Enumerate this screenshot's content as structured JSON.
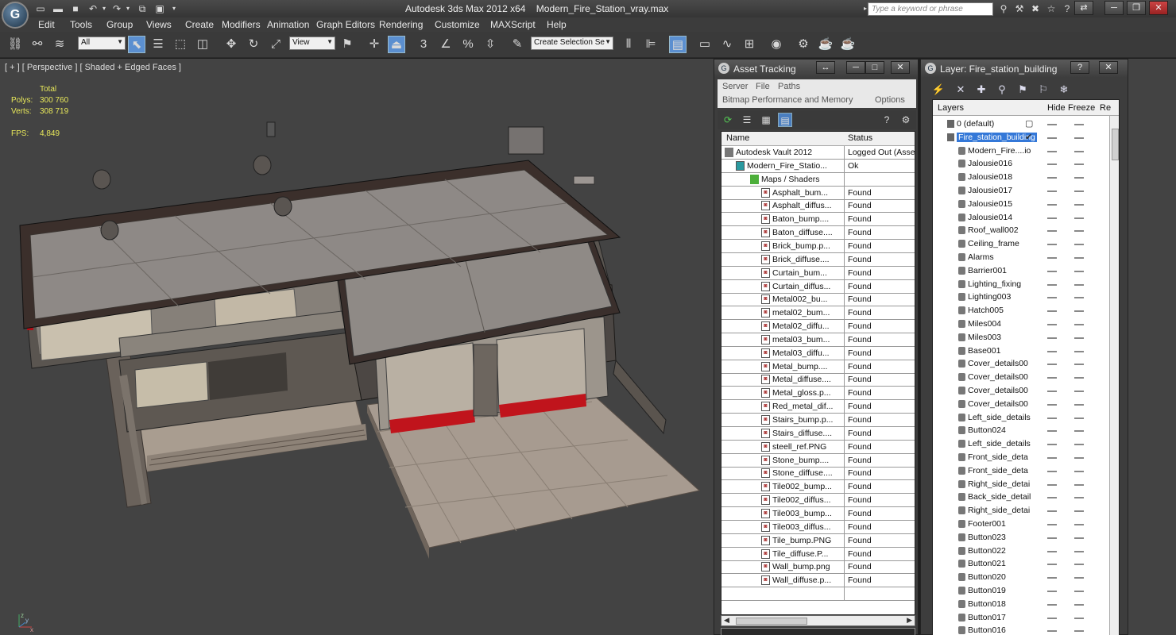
{
  "window": {
    "app_name": "Autodesk 3ds Max  2012 x64",
    "file_name": "Modern_Fire_Station_vray.max",
    "search_placeholder": "Type a keyword or phrase",
    "logo_letter": "G"
  },
  "menu": [
    "Edit",
    "Tools",
    "Group",
    "Views",
    "Create",
    "Modifiers",
    "Animation",
    "Graph Editors",
    "Rendering",
    "Customize",
    "MAXScript",
    "Help"
  ],
  "toolbar": {
    "filter_select": "All",
    "coord_select": "View",
    "selection_set": "Create Selection Se",
    "snap_labels": [
      "3",
      "%"
    ]
  },
  "viewport": {
    "label": "[ + ] [ Perspective ] [ Shaded + Edged Faces ]",
    "stats": {
      "total_label": "Total",
      "polys_label": "Polys:",
      "polys_value": "300 760",
      "verts_label": "Verts:",
      "verts_value": "308 719",
      "fps_label": "FPS:",
      "fps_value": "4,849"
    },
    "axis": {
      "x": "x",
      "y": "y",
      "z": "z"
    }
  },
  "asset_tracking": {
    "title": "Asset Tracking",
    "menu_row1": [
      "Server",
      "File",
      "Paths"
    ],
    "menu_row2": [
      "Bitmap Performance and Memory",
      "Options"
    ],
    "columns": {
      "name": "Name",
      "status": "Status"
    },
    "rows": [
      {
        "name": "Autodesk Vault 2012",
        "status": "Logged Out (Asse",
        "level": 0,
        "kind": "vault"
      },
      {
        "name": "Modern_Fire_Statio...",
        "status": "Ok",
        "level": 1,
        "kind": "max"
      },
      {
        "name": "Maps / Shaders",
        "status": "",
        "level": 2,
        "kind": "folder"
      },
      {
        "name": "Asphalt_bum...",
        "status": "Found",
        "level": 3,
        "kind": "file"
      },
      {
        "name": "Asphalt_diffus...",
        "status": "Found",
        "level": 3,
        "kind": "file"
      },
      {
        "name": "Baton_bump....",
        "status": "Found",
        "level": 3,
        "kind": "file"
      },
      {
        "name": "Baton_diffuse....",
        "status": "Found",
        "level": 3,
        "kind": "file"
      },
      {
        "name": "Brick_bump.p...",
        "status": "Found",
        "level": 3,
        "kind": "file"
      },
      {
        "name": "Brick_diffuse....",
        "status": "Found",
        "level": 3,
        "kind": "file"
      },
      {
        "name": "Curtain_bum...",
        "status": "Found",
        "level": 3,
        "kind": "file"
      },
      {
        "name": "Curtain_diffus...",
        "status": "Found",
        "level": 3,
        "kind": "file"
      },
      {
        "name": "Metal002_bu...",
        "status": "Found",
        "level": 3,
        "kind": "file"
      },
      {
        "name": "metal02_bum...",
        "status": "Found",
        "level": 3,
        "kind": "file"
      },
      {
        "name": "Metal02_diffu...",
        "status": "Found",
        "level": 3,
        "kind": "file"
      },
      {
        "name": "metal03_bum...",
        "status": "Found",
        "level": 3,
        "kind": "file"
      },
      {
        "name": "Metal03_diffu...",
        "status": "Found",
        "level": 3,
        "kind": "file"
      },
      {
        "name": "Metal_bump....",
        "status": "Found",
        "level": 3,
        "kind": "file"
      },
      {
        "name": "Metal_diffuse....",
        "status": "Found",
        "level": 3,
        "kind": "file"
      },
      {
        "name": "Metal_gloss.p...",
        "status": "Found",
        "level": 3,
        "kind": "file"
      },
      {
        "name": "Red_metal_dif...",
        "status": "Found",
        "level": 3,
        "kind": "file"
      },
      {
        "name": "Stairs_bump.p...",
        "status": "Found",
        "level": 3,
        "kind": "file"
      },
      {
        "name": "Stairs_diffuse....",
        "status": "Found",
        "level": 3,
        "kind": "file"
      },
      {
        "name": "steell_ref.PNG",
        "status": "Found",
        "level": 3,
        "kind": "file"
      },
      {
        "name": "Stone_bump....",
        "status": "Found",
        "level": 3,
        "kind": "file"
      },
      {
        "name": "Stone_diffuse....",
        "status": "Found",
        "level": 3,
        "kind": "file"
      },
      {
        "name": "Tile002_bump...",
        "status": "Found",
        "level": 3,
        "kind": "file"
      },
      {
        "name": "Tile002_diffus...",
        "status": "Found",
        "level": 3,
        "kind": "file"
      },
      {
        "name": "Tile003_bump...",
        "status": "Found",
        "level": 3,
        "kind": "file"
      },
      {
        "name": "Tile003_diffus...",
        "status": "Found",
        "level": 3,
        "kind": "file"
      },
      {
        "name": "Tile_bump.PNG",
        "status": "Found",
        "level": 3,
        "kind": "file"
      },
      {
        "name": "Tile_diffuse.P...",
        "status": "Found",
        "level": 3,
        "kind": "file"
      },
      {
        "name": "Wall_bump.png",
        "status": "Found",
        "level": 3,
        "kind": "file"
      },
      {
        "name": "Wall_diffuse.p...",
        "status": "Found",
        "level": 3,
        "kind": "file"
      },
      {
        "name": "",
        "status": "",
        "level": 0,
        "kind": "empty"
      }
    ]
  },
  "layer_panel": {
    "title": "Layer: Fire_station_building",
    "help": "?",
    "columns": {
      "layers": "Layers",
      "hide": "Hide",
      "freeze": "Freeze",
      "render": "Re"
    },
    "rows": [
      {
        "name": "0 (default)",
        "level": 0,
        "type": "layer",
        "mark": "box"
      },
      {
        "name": "Fire_station_building",
        "level": 0,
        "type": "layer",
        "selected": true,
        "mark": "check"
      },
      {
        "name": "Modern_Fire....io",
        "level": 1,
        "type": "object"
      },
      {
        "name": "Jalousie016",
        "level": 1,
        "type": "object"
      },
      {
        "name": "Jalousie018",
        "level": 1,
        "type": "object"
      },
      {
        "name": "Jalousie017",
        "level": 1,
        "type": "object"
      },
      {
        "name": "Jalousie015",
        "level": 1,
        "type": "object"
      },
      {
        "name": "Jalousie014",
        "level": 1,
        "type": "object"
      },
      {
        "name": "Roof_wall002",
        "level": 1,
        "type": "object"
      },
      {
        "name": "Ceiling_frame",
        "level": 1,
        "type": "object"
      },
      {
        "name": "Alarms",
        "level": 1,
        "type": "object"
      },
      {
        "name": "Barrier001",
        "level": 1,
        "type": "object"
      },
      {
        "name": "Lighting_fixing",
        "level": 1,
        "type": "object"
      },
      {
        "name": "Lighting003",
        "level": 1,
        "type": "object"
      },
      {
        "name": "Hatch005",
        "level": 1,
        "type": "object"
      },
      {
        "name": "Miles004",
        "level": 1,
        "type": "object"
      },
      {
        "name": "Miles003",
        "level": 1,
        "type": "object"
      },
      {
        "name": "Base001",
        "level": 1,
        "type": "object"
      },
      {
        "name": "Cover_details00",
        "level": 1,
        "type": "object"
      },
      {
        "name": "Cover_details00",
        "level": 1,
        "type": "object"
      },
      {
        "name": "Cover_details00",
        "level": 1,
        "type": "object"
      },
      {
        "name": "Cover_details00",
        "level": 1,
        "type": "object"
      },
      {
        "name": "Left_side_details",
        "level": 1,
        "type": "object"
      },
      {
        "name": "Button024",
        "level": 1,
        "type": "object"
      },
      {
        "name": "Left_side_details",
        "level": 1,
        "type": "object"
      },
      {
        "name": "Front_side_deta",
        "level": 1,
        "type": "object"
      },
      {
        "name": "Front_side_deta",
        "level": 1,
        "type": "object"
      },
      {
        "name": "Right_side_detai",
        "level": 1,
        "type": "object"
      },
      {
        "name": "Back_side_detail",
        "level": 1,
        "type": "object"
      },
      {
        "name": "Right_side_detai",
        "level": 1,
        "type": "object"
      },
      {
        "name": "Footer001",
        "level": 1,
        "type": "object"
      },
      {
        "name": "Button023",
        "level": 1,
        "type": "object"
      },
      {
        "name": "Button022",
        "level": 1,
        "type": "object"
      },
      {
        "name": "Button021",
        "level": 1,
        "type": "object"
      },
      {
        "name": "Button020",
        "level": 1,
        "type": "object"
      },
      {
        "name": "Button019",
        "level": 1,
        "type": "object"
      },
      {
        "name": "Button018",
        "level": 1,
        "type": "object"
      },
      {
        "name": "Button017",
        "level": 1,
        "type": "object"
      },
      {
        "name": "Button016",
        "level": 1,
        "type": "object"
      }
    ]
  },
  "colors": {
    "viewport_bg": "#434343",
    "stats_text": "#e8e85a",
    "selection_blue": "#3478d8",
    "garage_door_red": "#c0141c"
  }
}
